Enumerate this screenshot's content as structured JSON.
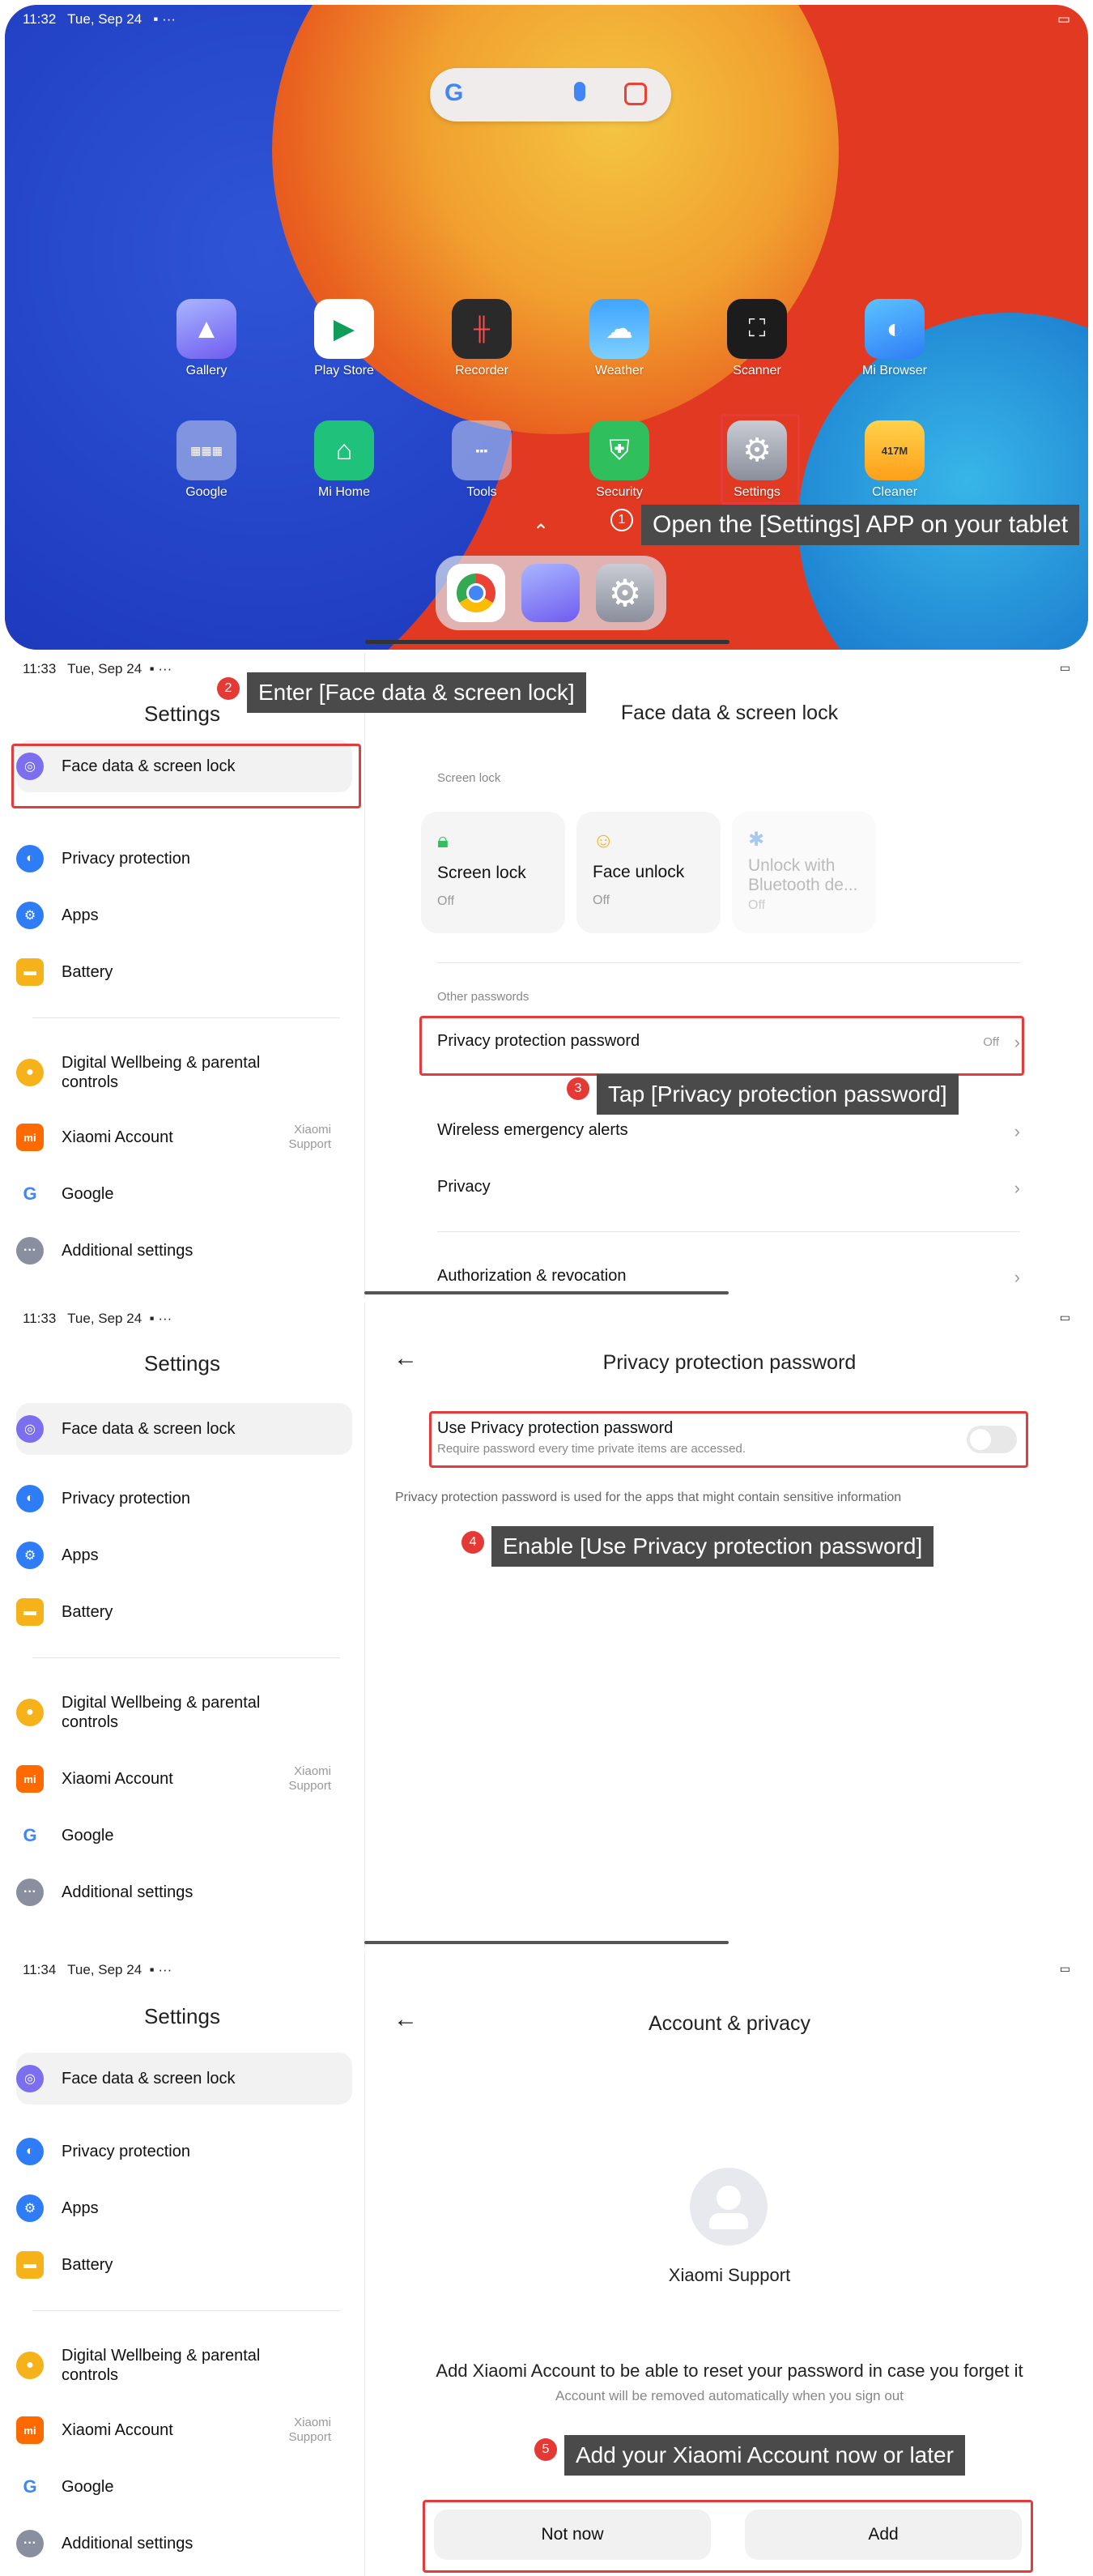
{
  "panel1": {
    "status_time": "11:32",
    "status_date": "Tue, Sep 24",
    "status_dots": "···",
    "apps_row1": [
      {
        "label": "Gallery",
        "icon": "gallery-icon"
      },
      {
        "label": "Play Store",
        "icon": "play-store-icon"
      },
      {
        "label": "Recorder",
        "icon": "recorder-icon"
      },
      {
        "label": "Weather",
        "icon": "weather-icon"
      },
      {
        "label": "Scanner",
        "icon": "scanner-icon"
      },
      {
        "label": "Mi Browser",
        "icon": "mi-browser-icon"
      }
    ],
    "apps_row2": [
      {
        "label": "Google",
        "icon": "google-folder-icon"
      },
      {
        "label": "Mi Home",
        "icon": "mi-home-icon"
      },
      {
        "label": "Tools",
        "icon": "tools-folder-icon"
      },
      {
        "label": "Security",
        "icon": "security-icon"
      },
      {
        "label": "Settings",
        "icon": "settings-icon"
      },
      {
        "label": "Cleaner",
        "icon": "cleaner-icon",
        "badge": "417M"
      }
    ],
    "step_num": "1",
    "callout": "Open the [Settings] APP on your tablet"
  },
  "sidebar": {
    "title": "Settings",
    "items": [
      {
        "label": "Face data & screen lock",
        "color": "#7b6ff0"
      },
      {
        "label": "Privacy protection",
        "color": "#2f7df6"
      },
      {
        "label": "Apps",
        "color": "#2f7df6"
      },
      {
        "label": "Battery",
        "color": "#f6b21b"
      },
      {
        "label": "Digital Wellbeing & parental controls",
        "color": "#f6b21b"
      },
      {
        "label": "Xiaomi Account",
        "color": "#ff6a00",
        "sub": "Xiaomi Support"
      },
      {
        "label": "Google",
        "color": "#ffffff"
      },
      {
        "label": "Additional settings",
        "color": "#8a8fa0"
      }
    ]
  },
  "panel2": {
    "status_time": "11:33",
    "status_date": "Tue, Sep 24",
    "step_num": "2",
    "callout": "Enter [Face data & screen lock]",
    "title": "Face data & screen lock",
    "screen_lock_label": "Screen lock",
    "cards": [
      {
        "label": "Screen lock",
        "state": "Off"
      },
      {
        "label": "Face unlock",
        "state": "Off"
      },
      {
        "label": "Unlock with Bluetooth de...",
        "state": "Off"
      }
    ],
    "other_passwords_label": "Other passwords",
    "privacy_password": "Privacy protection password",
    "privacy_password_state": "Off",
    "step3_num": "3",
    "callout3": "Tap [Privacy protection password]",
    "wireless": "Wireless emergency alerts",
    "privacy": "Privacy",
    "authorization": "Authorization & revocation"
  },
  "panel3": {
    "status_time": "11:33",
    "status_date": "Tue, Sep 24",
    "title": "Privacy protection password",
    "toggle_title": "Use Privacy protection password",
    "toggle_sub": "Require password every time private items are accessed.",
    "toggle_on": false,
    "note": "Privacy protection password is used for the apps that might contain sensitive information",
    "step_num": "4",
    "callout": "Enable [Use Privacy protection password]"
  },
  "panel4": {
    "status_time": "11:34",
    "status_date": "Tue, Sep 24",
    "title": "Account & privacy",
    "account_name": "Xiaomi Support",
    "message": "Add Xiaomi Account to be able to reset your password in case you forget it",
    "submessage": "Account will be removed automatically when you sign out",
    "step_num": "5",
    "callout": "Add your Xiaomi Account now or later",
    "not_now": "Not now",
    "add": "Add"
  },
  "colors": {
    "accent_red": "#e53b3b",
    "callout_bg": "#4a4a4a"
  }
}
